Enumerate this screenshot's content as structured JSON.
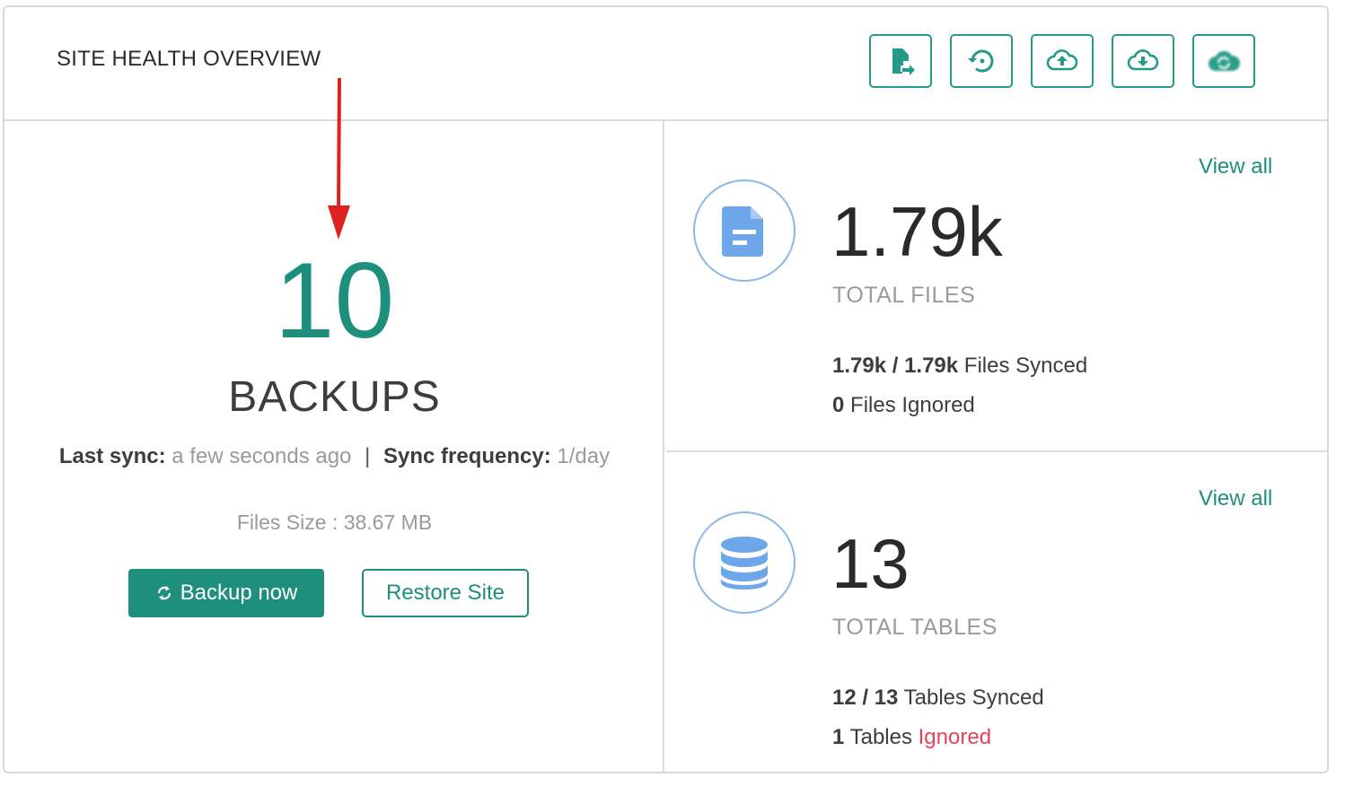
{
  "header": {
    "title": "SITE HEALTH OVERVIEW",
    "toolbar": [
      {
        "icon": "file-export-icon"
      },
      {
        "icon": "restore-history-icon"
      },
      {
        "icon": "cloud-upload-icon"
      },
      {
        "icon": "cloud-download-icon"
      },
      {
        "icon": "cloud-sync-icon"
      }
    ]
  },
  "backups": {
    "count": "10",
    "label": "BACKUPS",
    "last_sync_label": "Last sync:",
    "last_sync_value": "a few seconds ago",
    "separator": "|",
    "frequency_label": "Sync frequency:",
    "frequency_value": "1/day",
    "files_size": "Files Size : 38.67 MB",
    "backup_now_label": "Backup now",
    "restore_label": "Restore Site"
  },
  "files": {
    "view_all": "View all",
    "value": "1.79k",
    "label": "TOTAL FILES",
    "synced_count": "1.79k / 1.79k",
    "synced_text": "Files Synced",
    "ignored_count": "0",
    "ignored_text": "Files Ignored",
    "icon": "file-icon"
  },
  "tables": {
    "view_all": "View all",
    "value": "13",
    "label": "TOTAL TABLES",
    "synced_count": "12 / 13",
    "synced_text": "Tables Synced",
    "ignored_count": "1",
    "ignored_text": "Tables",
    "ignored_status": "Ignored",
    "icon": "database-icon"
  },
  "colors": {
    "accent": "#1f8f7d",
    "icon_blue": "#6ea6ea",
    "ignored_red": "#e8425a",
    "annotation_arrow": "#e02020"
  }
}
